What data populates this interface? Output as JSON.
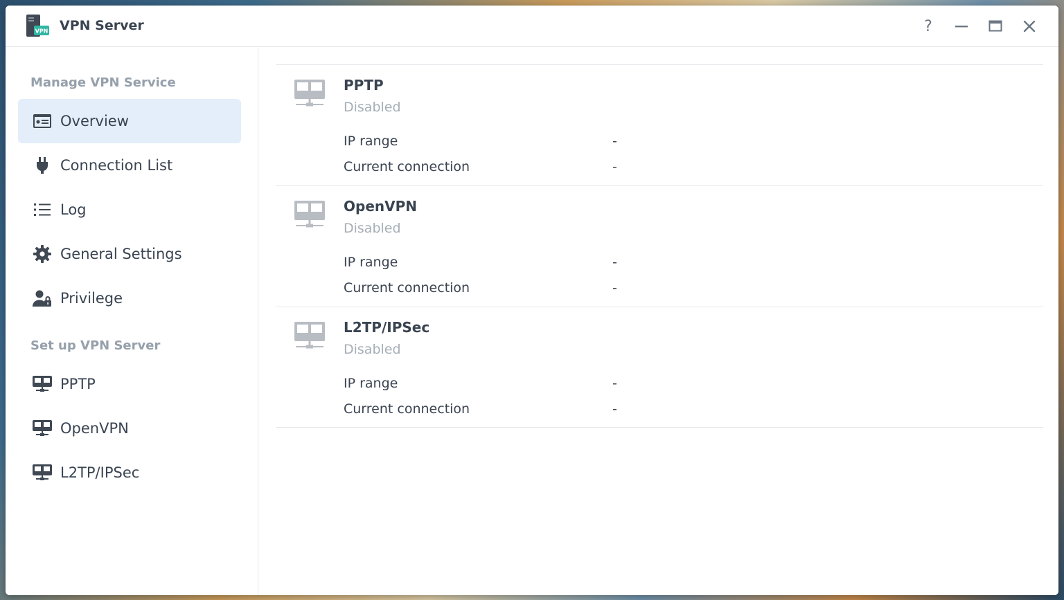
{
  "window": {
    "title": "VPN Server",
    "app_icon_badge": "VPN",
    "controls": {
      "help": "?"
    }
  },
  "sidebar": {
    "manage_title": "Manage VPN Service",
    "manage_items": [
      {
        "label": "Overview",
        "icon": "overview-card-icon",
        "active": true
      },
      {
        "label": "Connection List",
        "icon": "plug-icon"
      },
      {
        "label": "Log",
        "icon": "list-icon"
      },
      {
        "label": "General Settings",
        "icon": "gear-icon"
      },
      {
        "label": "Privilege",
        "icon": "user-lock-icon"
      }
    ],
    "setup_title": "Set up VPN Server",
    "setup_items": [
      {
        "label": "PPTP",
        "icon": "vpn-server-icon"
      },
      {
        "label": "OpenVPN",
        "icon": "vpn-server-icon"
      },
      {
        "label": "L2TP/IPSec",
        "icon": "vpn-server-icon"
      }
    ]
  },
  "overview": {
    "services": [
      {
        "name": "PPTP",
        "status": "Disabled",
        "ip_range_label": "IP range",
        "ip_range": "-",
        "current_connection_label": "Current connection",
        "current_connection": "-"
      },
      {
        "name": "OpenVPN",
        "status": "Disabled",
        "ip_range_label": "IP range",
        "ip_range": "-",
        "current_connection_label": "Current connection",
        "current_connection": "-"
      },
      {
        "name": "L2TP/IPSec",
        "status": "Disabled",
        "ip_range_label": "IP range",
        "ip_range": "-",
        "current_connection_label": "Current connection",
        "current_connection": "-"
      }
    ]
  },
  "colors": {
    "active_bg": "#e3eefa",
    "text": "#3a4451",
    "muted": "#95a0ab",
    "disabled": "#a6aeb6",
    "app_badge": "#2fb6a4"
  }
}
